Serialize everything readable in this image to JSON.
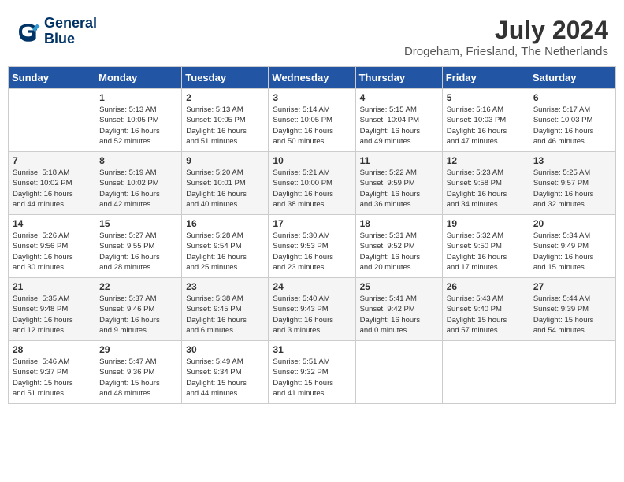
{
  "header": {
    "logo_line1": "General",
    "logo_line2": "Blue",
    "month_year": "July 2024",
    "location": "Drogeham, Friesland, The Netherlands"
  },
  "weekdays": [
    "Sunday",
    "Monday",
    "Tuesday",
    "Wednesday",
    "Thursday",
    "Friday",
    "Saturday"
  ],
  "weeks": [
    [
      {
        "day": "",
        "content": ""
      },
      {
        "day": "1",
        "content": "Sunrise: 5:13 AM\nSunset: 10:05 PM\nDaylight: 16 hours\nand 52 minutes."
      },
      {
        "day": "2",
        "content": "Sunrise: 5:13 AM\nSunset: 10:05 PM\nDaylight: 16 hours\nand 51 minutes."
      },
      {
        "day": "3",
        "content": "Sunrise: 5:14 AM\nSunset: 10:05 PM\nDaylight: 16 hours\nand 50 minutes."
      },
      {
        "day": "4",
        "content": "Sunrise: 5:15 AM\nSunset: 10:04 PM\nDaylight: 16 hours\nand 49 minutes."
      },
      {
        "day": "5",
        "content": "Sunrise: 5:16 AM\nSunset: 10:03 PM\nDaylight: 16 hours\nand 47 minutes."
      },
      {
        "day": "6",
        "content": "Sunrise: 5:17 AM\nSunset: 10:03 PM\nDaylight: 16 hours\nand 46 minutes."
      }
    ],
    [
      {
        "day": "7",
        "content": "Sunrise: 5:18 AM\nSunset: 10:02 PM\nDaylight: 16 hours\nand 44 minutes."
      },
      {
        "day": "8",
        "content": "Sunrise: 5:19 AM\nSunset: 10:02 PM\nDaylight: 16 hours\nand 42 minutes."
      },
      {
        "day": "9",
        "content": "Sunrise: 5:20 AM\nSunset: 10:01 PM\nDaylight: 16 hours\nand 40 minutes."
      },
      {
        "day": "10",
        "content": "Sunrise: 5:21 AM\nSunset: 10:00 PM\nDaylight: 16 hours\nand 38 minutes."
      },
      {
        "day": "11",
        "content": "Sunrise: 5:22 AM\nSunset: 9:59 PM\nDaylight: 16 hours\nand 36 minutes."
      },
      {
        "day": "12",
        "content": "Sunrise: 5:23 AM\nSunset: 9:58 PM\nDaylight: 16 hours\nand 34 minutes."
      },
      {
        "day": "13",
        "content": "Sunrise: 5:25 AM\nSunset: 9:57 PM\nDaylight: 16 hours\nand 32 minutes."
      }
    ],
    [
      {
        "day": "14",
        "content": "Sunrise: 5:26 AM\nSunset: 9:56 PM\nDaylight: 16 hours\nand 30 minutes."
      },
      {
        "day": "15",
        "content": "Sunrise: 5:27 AM\nSunset: 9:55 PM\nDaylight: 16 hours\nand 28 minutes."
      },
      {
        "day": "16",
        "content": "Sunrise: 5:28 AM\nSunset: 9:54 PM\nDaylight: 16 hours\nand 25 minutes."
      },
      {
        "day": "17",
        "content": "Sunrise: 5:30 AM\nSunset: 9:53 PM\nDaylight: 16 hours\nand 23 minutes."
      },
      {
        "day": "18",
        "content": "Sunrise: 5:31 AM\nSunset: 9:52 PM\nDaylight: 16 hours\nand 20 minutes."
      },
      {
        "day": "19",
        "content": "Sunrise: 5:32 AM\nSunset: 9:50 PM\nDaylight: 16 hours\nand 17 minutes."
      },
      {
        "day": "20",
        "content": "Sunrise: 5:34 AM\nSunset: 9:49 PM\nDaylight: 16 hours\nand 15 minutes."
      }
    ],
    [
      {
        "day": "21",
        "content": "Sunrise: 5:35 AM\nSunset: 9:48 PM\nDaylight: 16 hours\nand 12 minutes."
      },
      {
        "day": "22",
        "content": "Sunrise: 5:37 AM\nSunset: 9:46 PM\nDaylight: 16 hours\nand 9 minutes."
      },
      {
        "day": "23",
        "content": "Sunrise: 5:38 AM\nSunset: 9:45 PM\nDaylight: 16 hours\nand 6 minutes."
      },
      {
        "day": "24",
        "content": "Sunrise: 5:40 AM\nSunset: 9:43 PM\nDaylight: 16 hours\nand 3 minutes."
      },
      {
        "day": "25",
        "content": "Sunrise: 5:41 AM\nSunset: 9:42 PM\nDaylight: 16 hours\nand 0 minutes."
      },
      {
        "day": "26",
        "content": "Sunrise: 5:43 AM\nSunset: 9:40 PM\nDaylight: 15 hours\nand 57 minutes."
      },
      {
        "day": "27",
        "content": "Sunrise: 5:44 AM\nSunset: 9:39 PM\nDaylight: 15 hours\nand 54 minutes."
      }
    ],
    [
      {
        "day": "28",
        "content": "Sunrise: 5:46 AM\nSunset: 9:37 PM\nDaylight: 15 hours\nand 51 minutes."
      },
      {
        "day": "29",
        "content": "Sunrise: 5:47 AM\nSunset: 9:36 PM\nDaylight: 15 hours\nand 48 minutes."
      },
      {
        "day": "30",
        "content": "Sunrise: 5:49 AM\nSunset: 9:34 PM\nDaylight: 15 hours\nand 44 minutes."
      },
      {
        "day": "31",
        "content": "Sunrise: 5:51 AM\nSunset: 9:32 PM\nDaylight: 15 hours\nand 41 minutes."
      },
      {
        "day": "",
        "content": ""
      },
      {
        "day": "",
        "content": ""
      },
      {
        "day": "",
        "content": ""
      }
    ]
  ]
}
